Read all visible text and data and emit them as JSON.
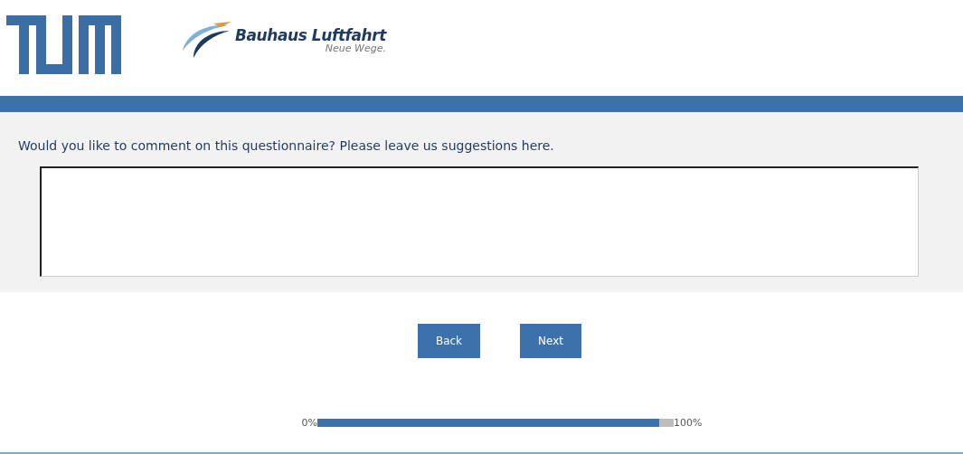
{
  "header": {
    "partner_name": "Bauhaus Luftfahrt",
    "partner_tagline": "Neue Wege."
  },
  "question": {
    "text": "Would you like to comment on this questionnaire? Please leave us suggestions here."
  },
  "buttons": [
    "Back",
    "Next"
  ],
  "progress": {
    "start_label": "0%",
    "end_label": "100%",
    "level": 0.96
  }
}
